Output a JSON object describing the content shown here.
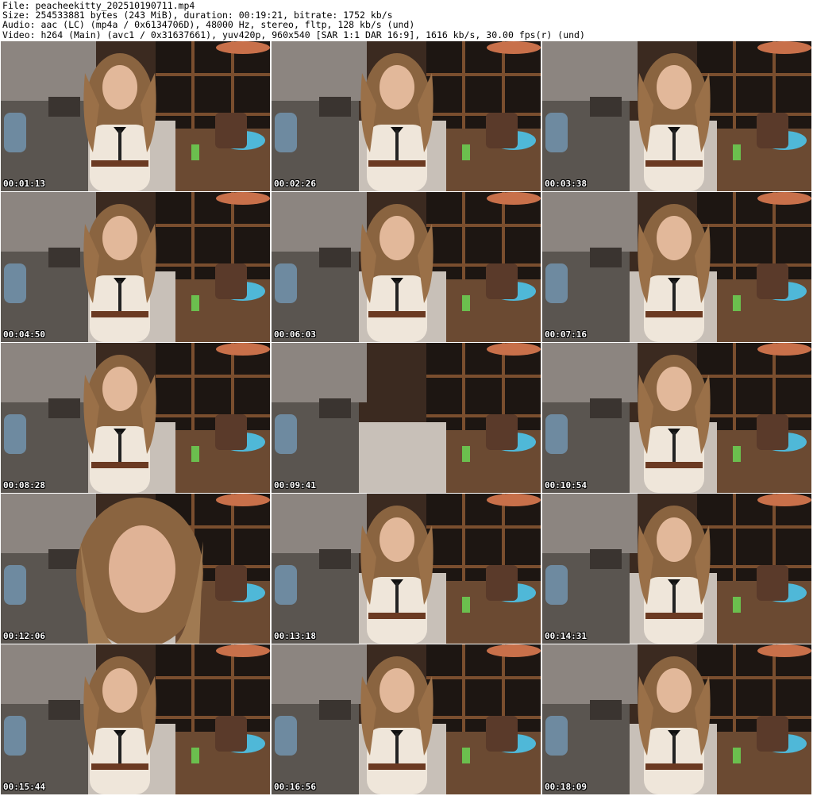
{
  "header": {
    "file": "File: peacheekitty_202510190711.mp4",
    "size": "Size: 254533881 bytes (243 MiB), duration: 00:19:21, bitrate: 1752 kb/s",
    "audio": "Audio: aac (LC) (mp4a / 0x6134706D), 48000 Hz, stereo, fltp, 128 kb/s (und)",
    "video": "Video: h264 (Main) (avc1 / 0x31637661), yuv420p, 960x540 [SAR 1:1 DAR 16:9], 1616 kb/s, 30.00 fps(r) (und)"
  },
  "thumbnails": [
    {
      "timestamp": "00:01:13",
      "person": "present"
    },
    {
      "timestamp": "00:02:26",
      "person": "present"
    },
    {
      "timestamp": "00:03:38",
      "person": "present"
    },
    {
      "timestamp": "00:04:50",
      "person": "present"
    },
    {
      "timestamp": "00:06:03",
      "person": "present"
    },
    {
      "timestamp": "00:07:16",
      "person": "present"
    },
    {
      "timestamp": "00:08:28",
      "person": "present"
    },
    {
      "timestamp": "00:09:41",
      "person": "absent"
    },
    {
      "timestamp": "00:10:54",
      "person": "present"
    },
    {
      "timestamp": "00:12:06",
      "person": "closeup"
    },
    {
      "timestamp": "00:13:18",
      "person": "present"
    },
    {
      "timestamp": "00:14:31",
      "person": "present"
    },
    {
      "timestamp": "00:15:44",
      "person": "present"
    },
    {
      "timestamp": "00:16:56",
      "person": "present"
    },
    {
      "timestamp": "00:18:09",
      "person": "present"
    }
  ]
}
